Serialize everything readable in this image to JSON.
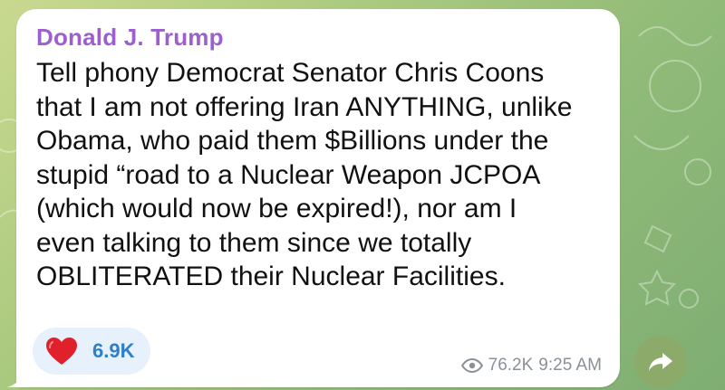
{
  "message": {
    "sender": "Donald J. Trump",
    "text": "Tell phony Democrat Senator Chris Coons\nthat I am not offering Iran ANYTHING, unlike\nObama, who paid them $Billions under the\nstupid “road to a Nuclear Weapon JCPOA\n(which would now be expired!), nor am I\neven talking to them since we totally\nOBLITERATED their Nuclear Facilities.",
    "reaction": {
      "icon": "heart-icon",
      "count": "6.9K"
    },
    "views": "76.2K",
    "time": "9:25 AM"
  },
  "colors": {
    "sender": "#9c5fd0",
    "reaction_bg": "#e6f1fb",
    "reaction_count": "#2f7ec9",
    "share_button": "#8cab6a",
    "heart": "#e0202a"
  }
}
